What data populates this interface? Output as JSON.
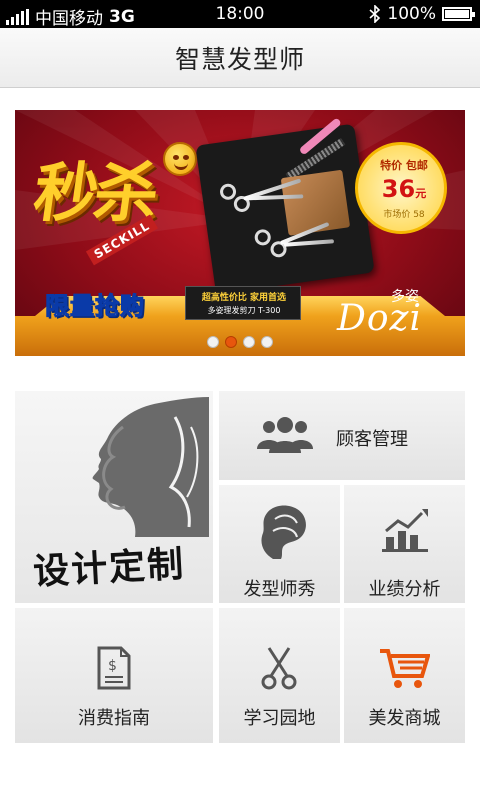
{
  "status_bar": {
    "carrier": "中国移动",
    "network": "3G",
    "time": "18:00",
    "battery": "100%",
    "battery_level": 1.0,
    "icons": [
      "signal-icon",
      "bluetooth-icon",
      "battery-icon"
    ]
  },
  "header": {
    "title": "智慧发型师"
  },
  "banner": {
    "headline": "秒杀",
    "seckill_en": "SECKILL",
    "limited_text": "限量抢购",
    "price_badge": {
      "label": "特价 包邮",
      "amount": "36",
      "unit": "元",
      "market": "市场价 58"
    },
    "promo_line1": "超高性价比  家用首选",
    "promo_line2": "多姿理发剪刀  T-300",
    "brand_cn": "多姿",
    "brand_en": "Dozi",
    "carousel_total": 4,
    "carousel_active": 2
  },
  "menu": {
    "design": "设计定制",
    "customer": "顾客管理",
    "hairstylist_show": "发型师秀",
    "performance": "业绩分析",
    "consumer_guide": "消费指南",
    "learning": "学习园地",
    "shop": "美发商城"
  },
  "colors": {
    "accent_orange": "#e8560d",
    "icon_gray": "#555555",
    "tile_bg": "#ececec"
  }
}
